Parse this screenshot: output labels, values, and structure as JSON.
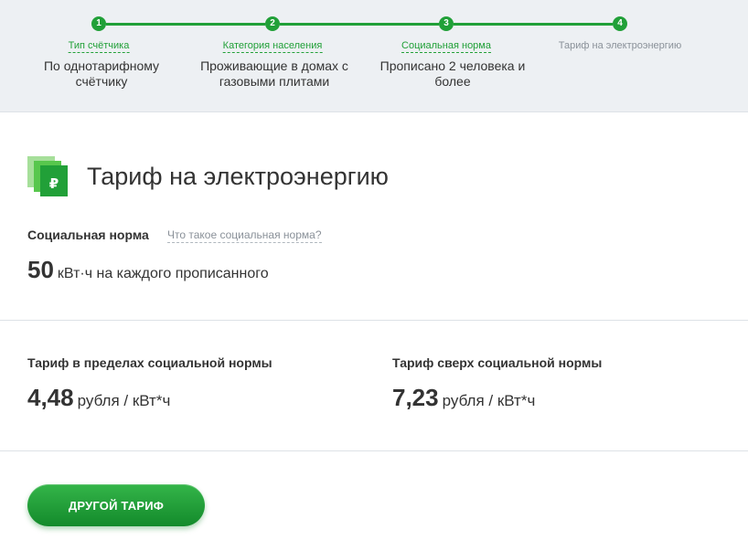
{
  "stepper": {
    "steps": [
      {
        "number": "1",
        "caption": "Тип счётчика",
        "value": "По однотарифному счётчику"
      },
      {
        "number": "2",
        "caption": "Категория населения",
        "value": "Проживающие в домах с газовыми плитами"
      },
      {
        "number": "3",
        "caption": "Социальная норма",
        "value": "Прописано 2 человека и более"
      },
      {
        "number": "4",
        "caption": "Тариф на электроэнергию",
        "value": ""
      }
    ]
  },
  "header": {
    "icon": "ruble-documents-icon",
    "title": "Тариф на электроэнергию"
  },
  "social_norm": {
    "label": "Социальная норма",
    "help_link": "Что такое социальная норма?",
    "value": "50",
    "unit": "кВт·ч на каждого прописанного"
  },
  "rates": {
    "within": {
      "label": "Тариф в пределах социальной нормы",
      "value": "4,48",
      "unit": "рубля / кВт*ч"
    },
    "above": {
      "label": "Тариф сверх социальной нормы",
      "value": "7,23",
      "unit": "рубля / кВт*ч"
    }
  },
  "actions": {
    "other_tariff_label": "ДРУГОЙ ТАРИФ"
  },
  "colors": {
    "accent": "#21a038",
    "stepper_bg": "#edf0f3",
    "text": "#333333",
    "muted": "#8a9199"
  }
}
